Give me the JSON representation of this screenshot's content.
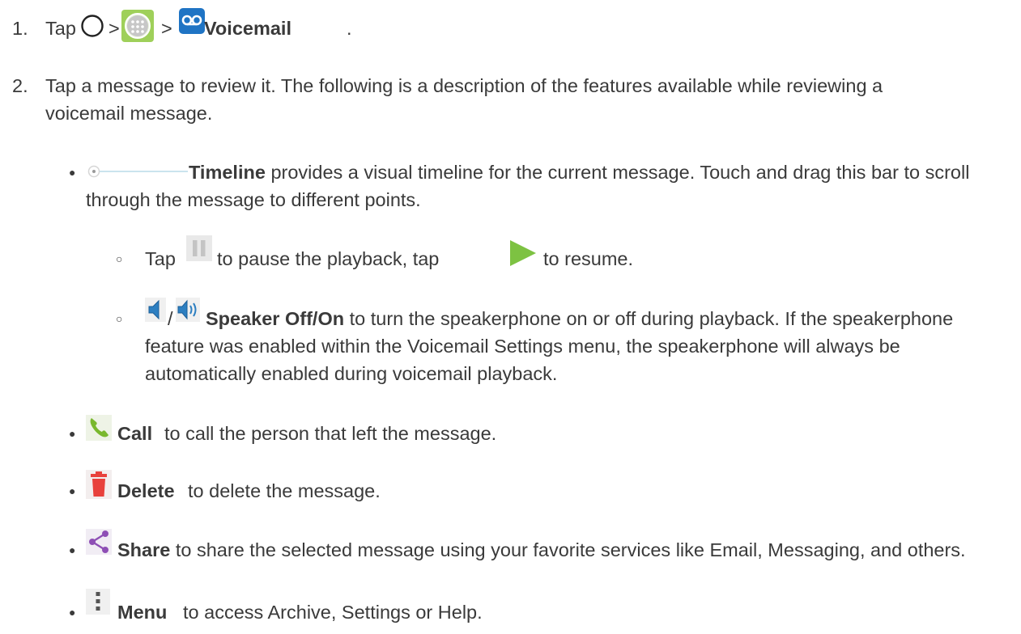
{
  "steps": {
    "s1": {
      "num": "1.",
      "tap": "Tap",
      "sep1": ">",
      "sep2": ">",
      "target": "Voicemail",
      "end": "."
    },
    "s2": {
      "num": "2.",
      "text": "Tap a message to review it. The following is a description of the features available while reviewing a voicemail message."
    }
  },
  "features": {
    "timeline": {
      "title": "Timeline",
      "text": "provides a visual timeline for the current message. Touch and drag this bar to scroll through the message to different points."
    },
    "pause": {
      "tap1": "Tap",
      "mid": "to pause the playback, tap",
      "end": "to resume."
    },
    "speaker": {
      "slash": "/",
      "title": "Speaker Off/On",
      "text": "to turn the speakerphone on or off during playback. If the speakerphone feature was enabled within the Voicemail Settings menu, the speakerphone will always be automatically enabled during voicemail playback."
    },
    "call": {
      "title": "Call",
      "text": "to call the person that left the message."
    },
    "delete": {
      "title": "Delete",
      "text": "to delete the message."
    },
    "share": {
      "title": "Share",
      "text": "to share the selected message using your favorite services like Email, Messaging, and others."
    },
    "menu": {
      "title": "Menu",
      "text": "to access Archive, Settings or Help."
    }
  },
  "colors": {
    "text": "#3a3a3a",
    "play_green": "#7dc242",
    "call_green": "#79b82e",
    "delete_red": "#e8413c",
    "share_purple": "#8e4fb5",
    "speaker_blue": "#2d7fc1",
    "voicemail_blue": "#1f74c4"
  },
  "icons": [
    "home-circle-icon",
    "apps-icon",
    "voicemail-icon",
    "timeline-icon",
    "pause-icon",
    "play-icon",
    "speaker-off-icon",
    "speaker-on-icon",
    "call-icon",
    "delete-icon",
    "share-icon",
    "menu-icon"
  ]
}
